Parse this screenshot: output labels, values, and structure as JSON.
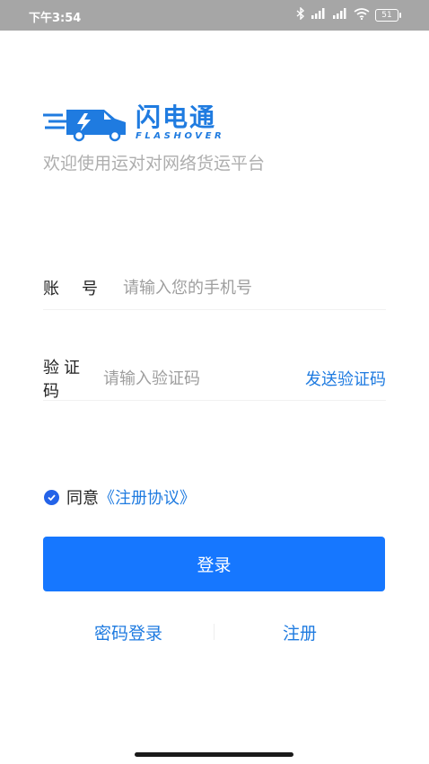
{
  "status_bar": {
    "time": "下午3:54",
    "battery": "51",
    "icons": [
      "bluetooth-icon",
      "signal-icon",
      "signal-icon",
      "wifi-icon",
      "battery-icon"
    ]
  },
  "brand": {
    "name_cn": "闪电通",
    "name_en": "FLASHOVER",
    "tagline": "欢迎使用运对对网络货运平台",
    "color": "#1f7be0"
  },
  "form": {
    "account_label": "账号",
    "account_placeholder": "请输入您的手机号",
    "code_label": "验证码",
    "code_placeholder": "请输入验证码",
    "send_code": "发送验证码"
  },
  "agreement": {
    "prefix": "同意",
    "link": "《注册协议》",
    "checked": true
  },
  "login_button": "登录",
  "links": {
    "password_login": "密码登录",
    "register": "注册"
  },
  "colors": {
    "primary": "#1677ff",
    "link": "#1f7be0",
    "status_bar": "#a6a6a6"
  }
}
